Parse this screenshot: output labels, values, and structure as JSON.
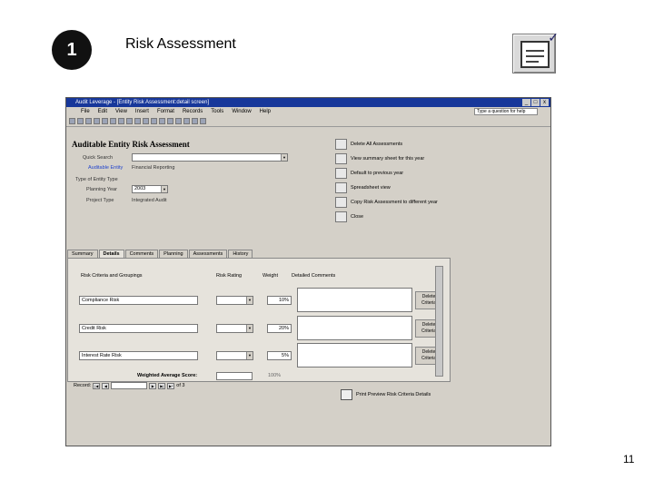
{
  "slide": {
    "number": "1",
    "title": "Risk Assessment",
    "page_number": "11"
  },
  "window": {
    "title": "Audit Leverage - [Entity Risk Assessment:detail screen]",
    "menu": [
      "File",
      "Edit",
      "View",
      "Insert",
      "Format",
      "Records",
      "Tools",
      "Window",
      "Help"
    ],
    "help_placeholder": "Type a question for help"
  },
  "form": {
    "title": "Auditable Entity Risk Assessment",
    "quick_search_label": "Quick Search",
    "quick_search_value": "",
    "auditable_entity_label": "Auditable Entity",
    "auditable_entity_value": "Financial Reporting",
    "type_label": "Type of Entity Type",
    "planning_year_label": "Planning Year",
    "planning_year_value": "2003",
    "project_type_label": "Project Type",
    "project_type_value": "Integrated Audit",
    "actions": [
      {
        "label": "Delete All Assessments",
        "icon": "printer-icon"
      },
      {
        "label": "View summary sheet for this year",
        "icon": "filter-icon"
      },
      {
        "label": "Default to previous year",
        "icon": "chart-icon"
      },
      {
        "label": "Spreadsheet view",
        "icon": "grid-icon"
      },
      {
        "label": "Copy Risk Assessment to different year",
        "icon": "copy-icon"
      },
      {
        "label": "Close",
        "icon": "globe-icon"
      }
    ],
    "tabs": [
      "Summary",
      "Details",
      "Comments",
      "Planning",
      "Assessments",
      "History"
    ],
    "active_tab": "Details",
    "columns": {
      "criteria": "Risk Criteria and Groupings",
      "rating": "Risk Rating",
      "weight": "Weight",
      "comment": "Detailed Comments"
    },
    "rows": [
      {
        "criteria": "Compliance Risk",
        "rating": "",
        "weight": "10%",
        "delete": "Delete Criteria"
      },
      {
        "criteria": "Credit Risk",
        "rating": "",
        "weight": "20%",
        "delete": "Delete Criteria"
      },
      {
        "criteria": "Interest Rate Risk",
        "rating": "",
        "weight": "5%",
        "delete": "Delete Criteria"
      }
    ],
    "weighted_average_label": "Weighted Average Score:",
    "weighted_average_value": "",
    "weight_total": "100%",
    "record_label": "Record:",
    "record_of": "of 3",
    "print_label": "Print Preview Risk Criteria Details"
  }
}
